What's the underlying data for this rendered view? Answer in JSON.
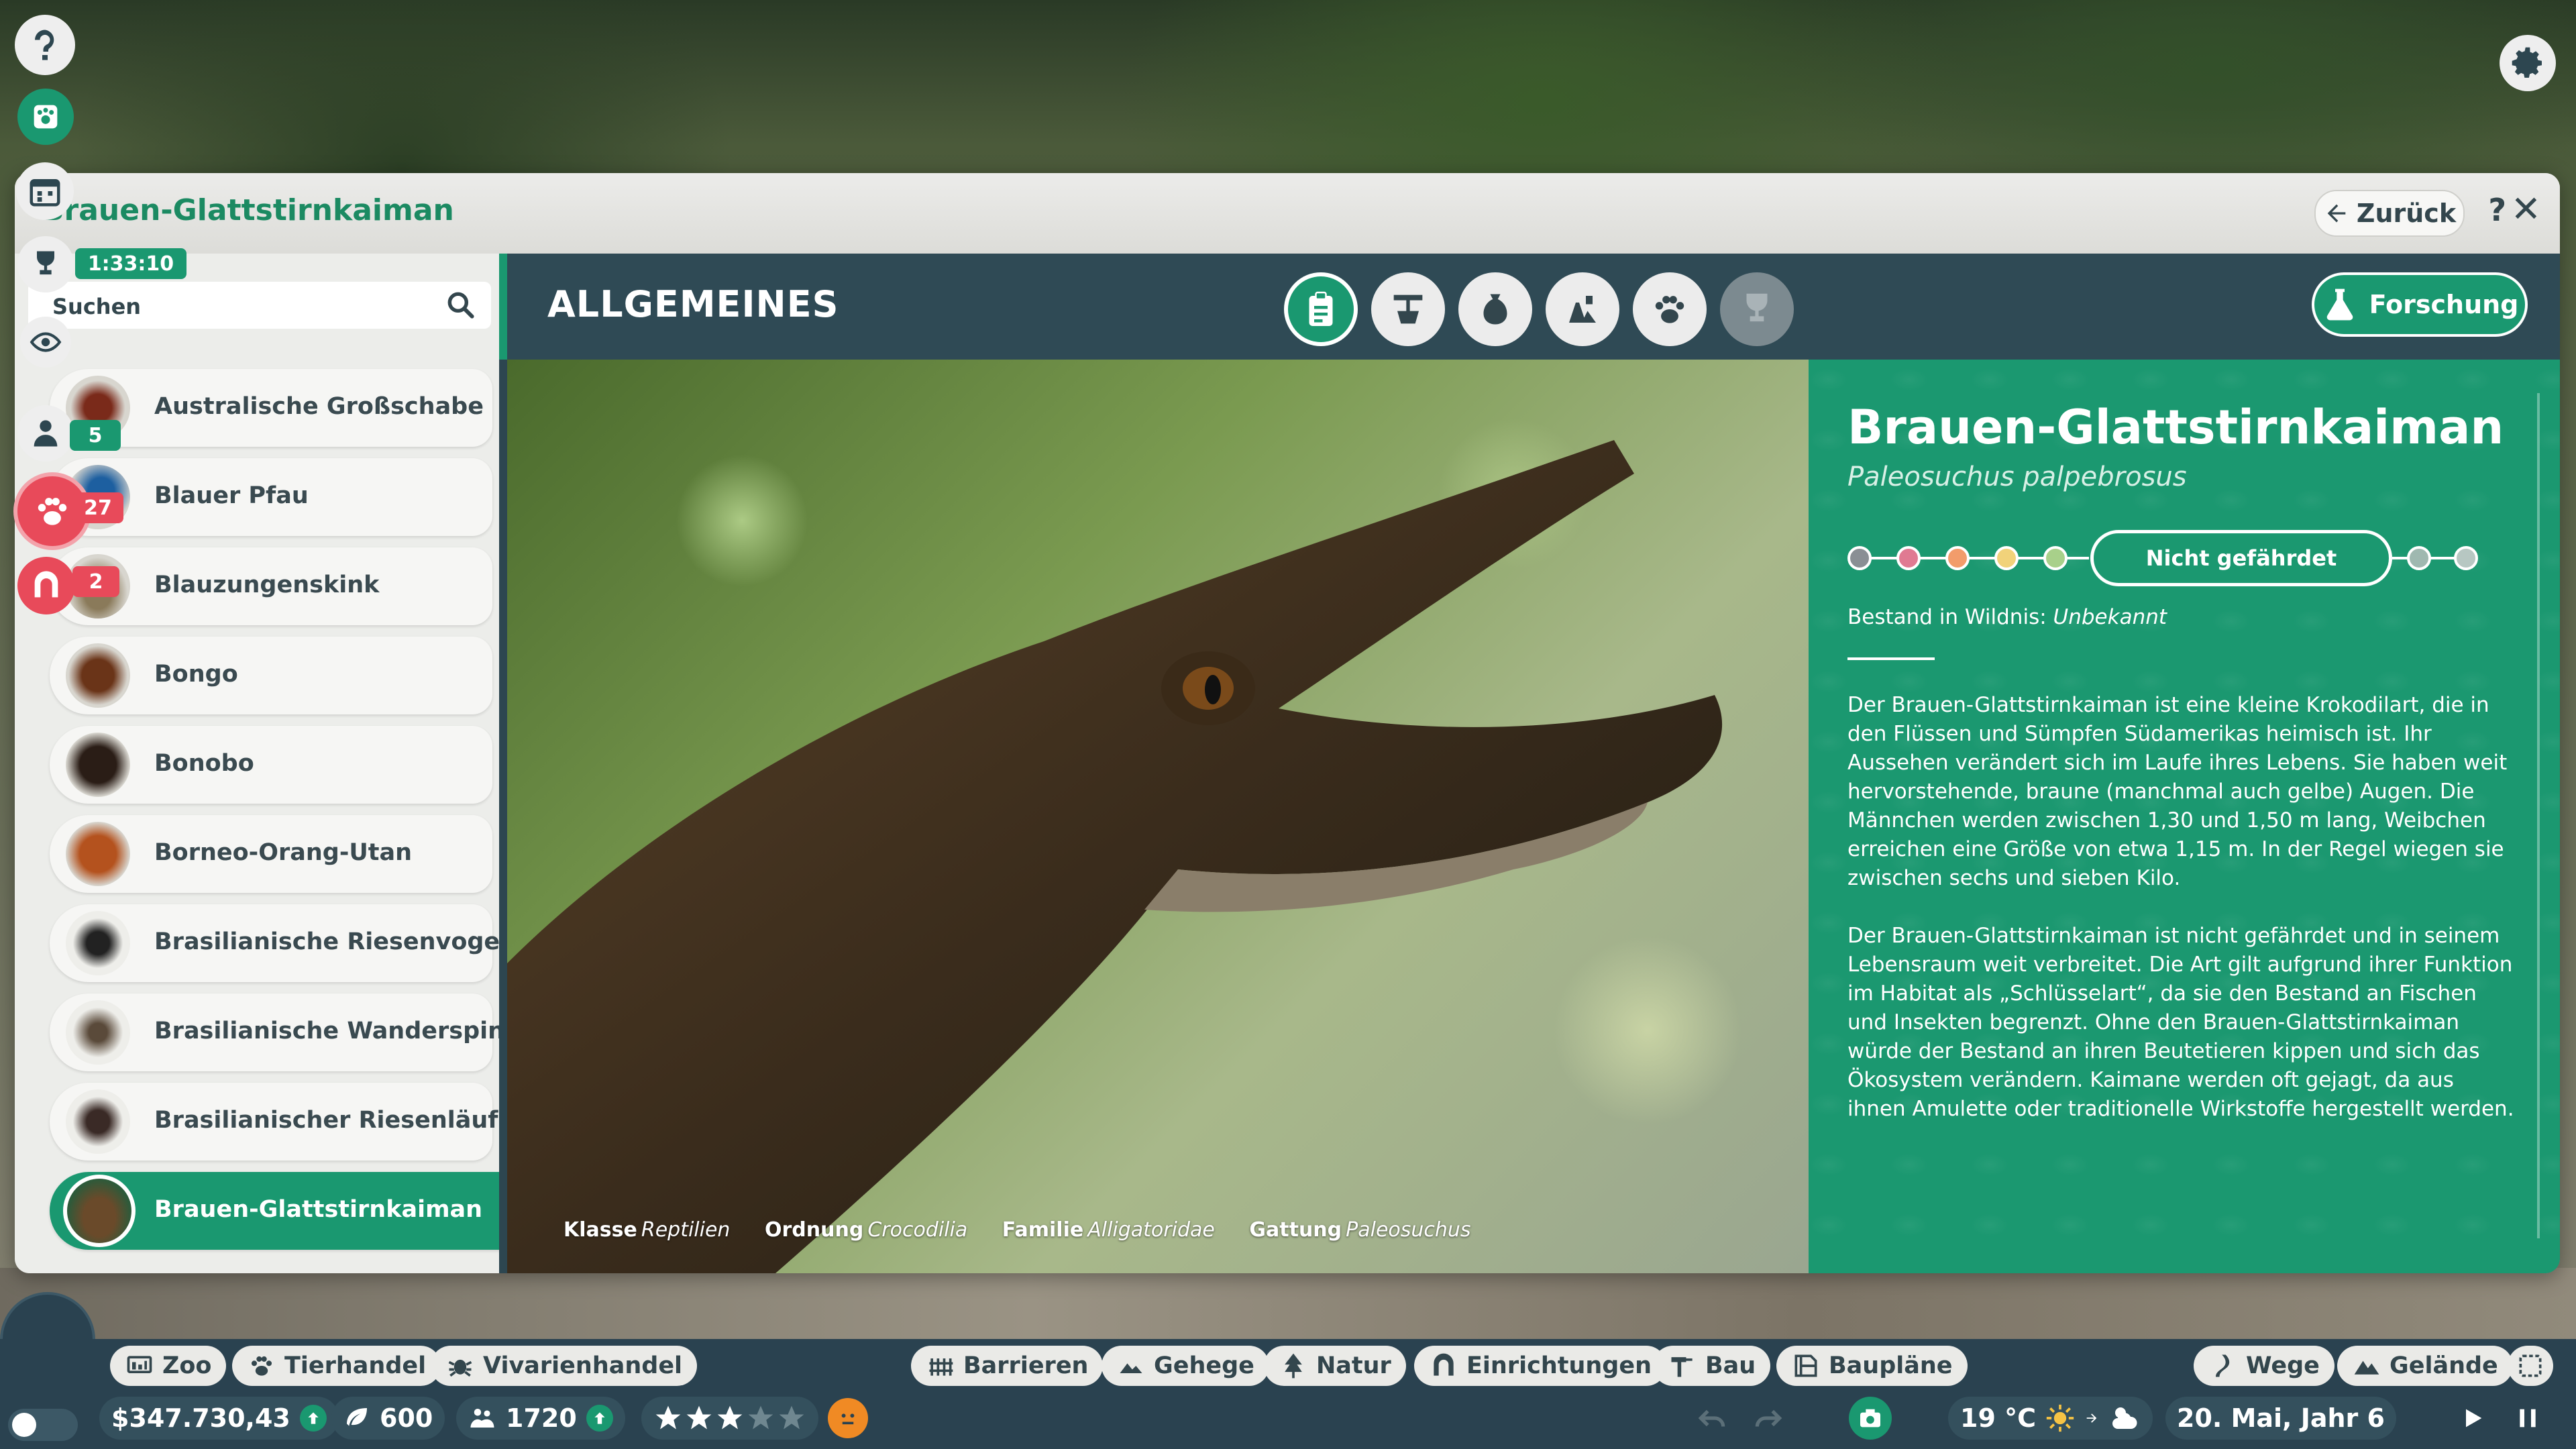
{
  "hud": {
    "timer": "1:33:10",
    "badges": {
      "staff": "5",
      "animals": "27",
      "facilities": "2"
    }
  },
  "window": {
    "title": "Brauen-Glattstirnkaiman",
    "back_label": "Zurück",
    "help_label": "?",
    "close_label": "✕"
  },
  "search": {
    "placeholder": "Suchen"
  },
  "species_list": [
    {
      "name": "Australische Großschabe"
    },
    {
      "name": "Blauer Pfau"
    },
    {
      "name": "Blauzungenskink"
    },
    {
      "name": "Bongo"
    },
    {
      "name": "Bonobo"
    },
    {
      "name": "Borneo-Orang-Utan"
    },
    {
      "name": "Brasilianische Riesenvogels..."
    },
    {
      "name": "Brasilianische Wanderspinne"
    },
    {
      "name": "Brasilianischer Riesenläufer"
    },
    {
      "name": "Brauen-Glattstirnkaiman",
      "selected": true
    }
  ],
  "section": {
    "title": "ALLGEMEINES",
    "research_label": "Forschung",
    "tabs": [
      {
        "icon": "clipboard-icon",
        "active": true
      },
      {
        "icon": "habitat-icon"
      },
      {
        "icon": "food-sack-icon"
      },
      {
        "icon": "enrichment-icon"
      },
      {
        "icon": "paw-icon"
      },
      {
        "icon": "trophy-icon",
        "disabled": true
      }
    ]
  },
  "taxonomy": {
    "class_label": "Klasse",
    "class_value": "Reptilien",
    "order_label": "Ordnung",
    "order_value": "Crocodilia",
    "family_label": "Familie",
    "family_value": "Alligatoridae",
    "genus_label": "Gattung",
    "genus_value": "Paleosuchus"
  },
  "info": {
    "name": "Brauen-Glattstirnkaiman",
    "scientific_name": "Paleosuchus palpebrosus",
    "status_label": "Nicht gefährdet",
    "status_colors": [
      "#8a8f94",
      "#e07a92",
      "#f29c6b",
      "#f1d27a",
      "#a8d08a",
      "#9fd4bf",
      "#9fd4bf"
    ],
    "wild_label": "Bestand in Wildnis:",
    "wild_value": "Unbekannt",
    "description_1": "Der Brauen-Glattstirnkaiman ist eine kleine Krokodilart, die in den Flüssen und Sümpfen Südamerikas heimisch ist. Ihr Aussehen verändert sich im Laufe ihres Lebens. Sie haben weit hervorstehende, braune (manchmal auch gelbe) Augen. Die Männchen werden zwischen 1,30 und 1,50 m lang, Weibchen erreichen eine Größe von etwa 1,15 m. In der Regel wiegen sie zwischen sechs und sieben Kilo.",
    "description_2": "Der Brauen-Glattstirnkaiman ist nicht gefährdet und in seinem Lebensraum weit verbreitet. Die Art gilt aufgrund ihrer Funktion im Habitat als „Schlüsselart“, da sie den Bestand an Fischen und Insekten begrenzt. Ohne den Brauen-Glattstirnkaiman würde der Bestand an ihren Beutetieren kippen und sich das Ökosystem verändern. Kaimane werden oft gejagt, da aus ihnen Amulette oder traditionelle Wirkstoffe hergestellt werden."
  },
  "toolbar": {
    "zoo": "Zoo",
    "animal_trade": "Tierhandel",
    "vivarium_trade": "Vivarienhandel",
    "barriers": "Barrieren",
    "habitats": "Gehege",
    "nature": "Natur",
    "facilities": "Einrichtungen",
    "build": "Bau",
    "blueprints": "Baupläne",
    "paths": "Wege",
    "terrain": "Gelände"
  },
  "status_bar": {
    "money": "$347.730,43",
    "conservation": "600",
    "guests": "1720",
    "rating_stars": 3,
    "rating_max": 5,
    "temperature": "19 °C",
    "date": "20. Mai, Jahr 6"
  },
  "colors": {
    "accent": "#1a9870",
    "panel": "#2d4650",
    "toolbar": "#2a4250"
  }
}
